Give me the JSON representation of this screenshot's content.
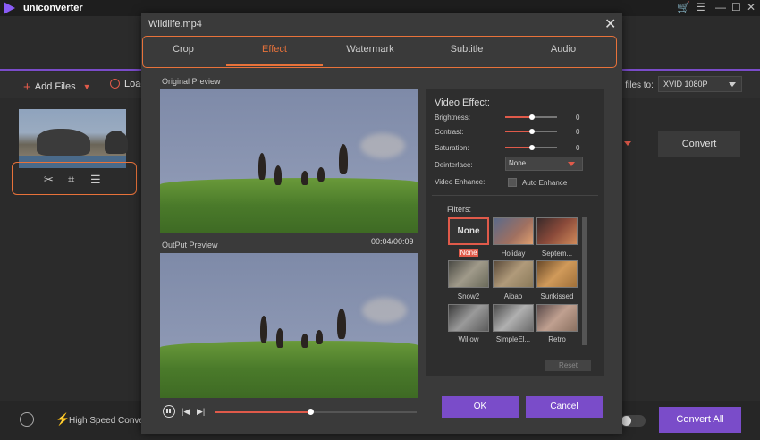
{
  "app": {
    "name": "uniconverter"
  },
  "window_controls": {
    "cart_icon": "cart-icon",
    "menu_icon": "menu-icon",
    "minimize": "—",
    "maximize": "☐",
    "close": "✕"
  },
  "toolbar": {
    "add_files": "Add Files",
    "load": "Load",
    "all_files_to": "ll files to:",
    "format": "XVID 1080P"
  },
  "main": {
    "convert": "Convert"
  },
  "bottom": {
    "high_speed": "High Speed Convers",
    "convert_all": "Convert All"
  },
  "dialog": {
    "title": "Wildlife.mp4",
    "tabs": [
      {
        "label": "Crop"
      },
      {
        "label": "Effect",
        "active": true
      },
      {
        "label": "Watermark"
      },
      {
        "label": "Subtitle"
      },
      {
        "label": "Audio"
      }
    ],
    "original_preview": "Original Preview",
    "output_preview": "OutPut Preview",
    "timecode": "00:04/00:09",
    "video_effect": {
      "title": "Video Effect:",
      "brightness": {
        "label": "Brightness:",
        "value": "0"
      },
      "contrast": {
        "label": "Contrast:",
        "value": "0"
      },
      "saturation": {
        "label": "Saturation:",
        "value": "0"
      },
      "deinterlace": {
        "label": "Deinterlace:",
        "value": "None"
      },
      "enhance": {
        "label": "Video Enhance:",
        "checkbox_label": "Auto Enhance"
      }
    },
    "filters": {
      "title": "Filters:",
      "none_thumb_text": "None",
      "items": [
        "None",
        "Holiday",
        "Septem...",
        "Snow2",
        "Aibao",
        "Sunkissed",
        "Willow",
        "SimpleEl...",
        "Retro"
      ]
    },
    "reset": "Reset",
    "ok": "OK",
    "cancel": "Cancel"
  },
  "colors": {
    "accent_purple": "#7a4cc9",
    "accent_orange": "#e8723a",
    "accent_red": "#e05a4a"
  }
}
